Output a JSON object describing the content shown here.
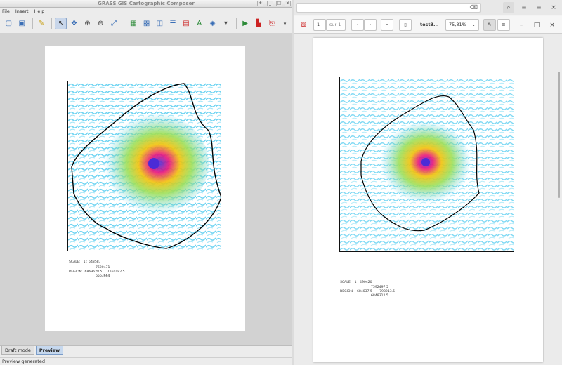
{
  "grass_window": {
    "title": "GRASS GIS Cartographic Composer",
    "menu": [
      "File",
      "Insert",
      "Help"
    ],
    "toolbar_icons": [
      "new-page-icon",
      "save-icon",
      "page-setup-icon",
      "pointer-icon",
      "pan-icon",
      "zoom-in-icon",
      "zoom-out-icon",
      "zoom-extent-icon",
      "add-map-icon",
      "add-raster-icon",
      "add-vector-icon",
      "add-legend-icon",
      "add-scalebar-icon",
      "add-text-icon",
      "add-image-icon",
      "add-point-icon",
      "generate-output-icon",
      "export-pdf-icon",
      "export-script-icon"
    ],
    "map_info": {
      "scale": "SCALE:   1 : 543587",
      "region_north": "7620471",
      "region": "REGION:  6869628.5     7160182.5",
      "region_south": "6563664"
    },
    "tabs": [
      "Draft mode",
      "Preview"
    ],
    "active_tab": "Preview",
    "status": "Preview generated"
  },
  "pdf_viewer": {
    "page_number": "1",
    "page_count": "sur 1",
    "doc_title": "test3...",
    "zoom": "75,81%",
    "map_info": {
      "scale": "SCALE:   1 : 490420",
      "region_north": "7592497.5",
      "region": "REGION:   684037.5       793213.5",
      "region_south": "6848312.5"
    }
  },
  "colors": {
    "accent": "#3b6fb6",
    "water": "#5ad0f0",
    "contour": "#000000"
  }
}
